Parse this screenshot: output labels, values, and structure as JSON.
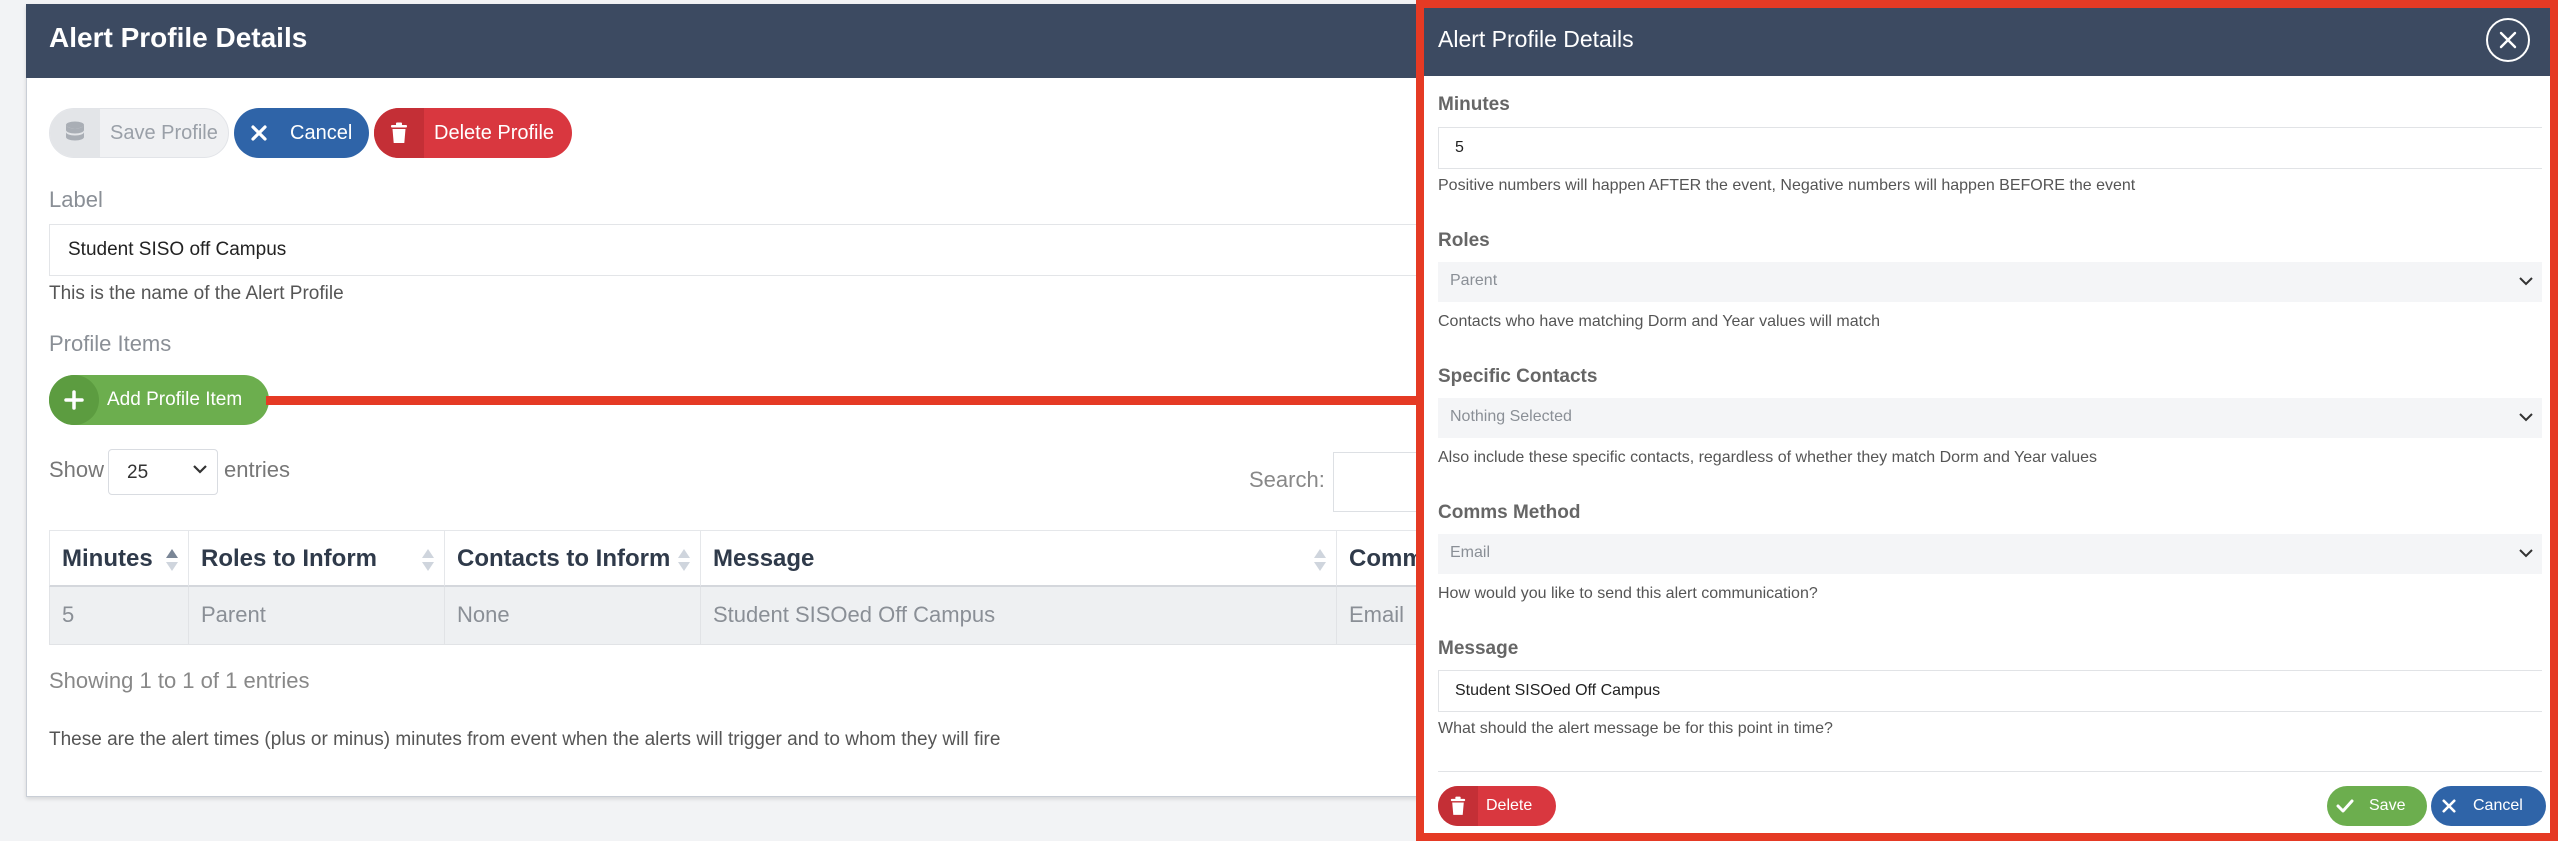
{
  "page": {
    "title": "Alert Profile Details",
    "buttons": {
      "save_profile": "Save Profile",
      "cancel": "Cancel",
      "delete_profile": "Delete Profile",
      "add_profile_item": "Add Profile Item"
    },
    "label_field": {
      "heading": "Label",
      "value": "Student SISO off Campus",
      "help": "This is the name of the Alert Profile"
    },
    "profile_items_heading": "Profile Items",
    "table": {
      "show_label": "Show",
      "entries_value": "25",
      "entries_label": "entries",
      "search_label": "Search:",
      "columns": [
        "Minutes",
        "Roles to Inform",
        "Contacts to Inform",
        "Message",
        "Comm"
      ],
      "rows": [
        [
          "5",
          "Parent",
          "None",
          "Student SISOed Off Campus",
          "Email"
        ]
      ],
      "info": "Showing 1 to 1 of 1 entries"
    },
    "footnote": "These are the alert times (plus or minus) minutes from event when the alerts will trigger and to whom they will fire"
  },
  "modal": {
    "title": "Alert Profile Details",
    "minutes": {
      "label": "Minutes",
      "value": "5",
      "help": "Positive numbers will happen AFTER the event, Negative numbers will happen BEFORE the event"
    },
    "roles": {
      "label": "Roles",
      "value": "Parent",
      "help": "Contacts who have matching Dorm and Year values will match"
    },
    "specific_contacts": {
      "label": "Specific Contacts",
      "value": "Nothing Selected",
      "help": "Also include these specific contacts, regardless of whether they match Dorm and Year values"
    },
    "comms_method": {
      "label": "Comms Method",
      "value": "Email",
      "help": "How would you like to send this alert communication?"
    },
    "message": {
      "label": "Message",
      "value": "Student SISOed Off Campus",
      "help": "What should the alert message be for this point in time?"
    },
    "buttons": {
      "delete": "Delete",
      "save": "Save",
      "cancel": "Cancel"
    }
  },
  "colors": {
    "header": "#3c4a61",
    "primary_blue": "#2f64a8",
    "danger_red": "#d9373f",
    "success_green": "#6cae4e",
    "highlight_outline": "#e53a24"
  },
  "icons": [
    "database-icon",
    "close-icon",
    "trash-icon",
    "plus-icon",
    "chevron-down-icon",
    "sort-icon",
    "close-circle-icon",
    "check-icon"
  ]
}
